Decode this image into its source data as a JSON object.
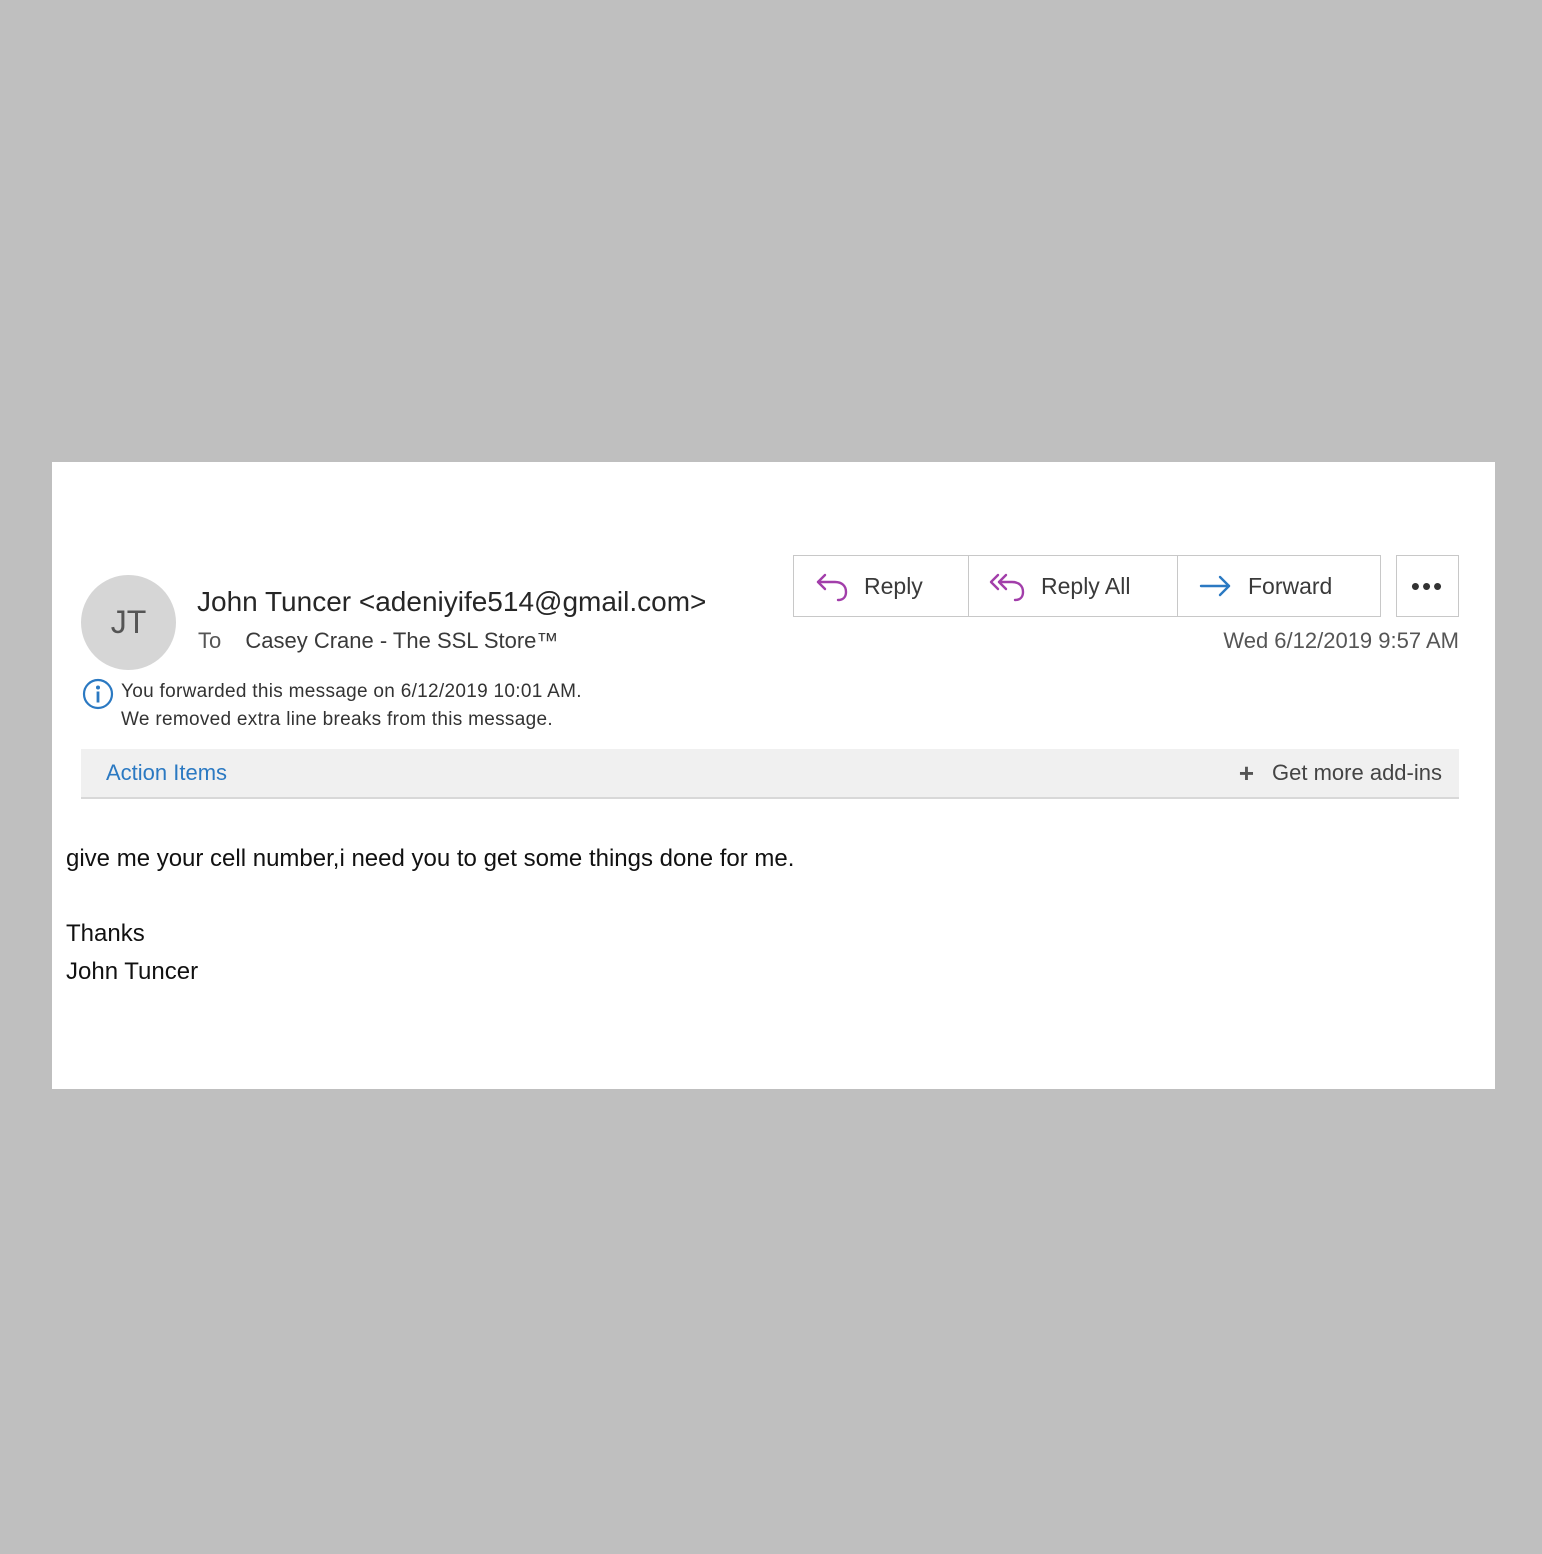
{
  "sender": {
    "initials": "JT",
    "display": "John Tuncer <adeniyife514@gmail.com>"
  },
  "recipient": {
    "label": "To",
    "name": "Casey Crane - The SSL Store™"
  },
  "toolbar": {
    "reply_label": "Reply",
    "reply_all_label": "Reply All",
    "forward_label": "Forward",
    "more_label": "•••"
  },
  "received": "Wed 6/12/2019 9:57 AM",
  "info": {
    "line1": "You forwarded this message on 6/12/2019 10:01 AM.",
    "line2": "We removed extra line breaks from this message."
  },
  "addins": {
    "action_items": "Action Items",
    "plus": "+",
    "get_more": "Get more add-ins"
  },
  "message": {
    "line1": "give me your cell number,i need you to get some things done for me.",
    "line2": "Thanks",
    "line3": "John Tuncer"
  },
  "colors": {
    "reply_icon": "#a23eaa",
    "forward_icon": "#2b79c2",
    "link": "#2b79c2",
    "background": "#bfbfbf"
  },
  "icons": {
    "reply": "reply-icon",
    "reply_all": "reply-all-icon",
    "forward": "forward-icon",
    "info": "info-icon"
  }
}
